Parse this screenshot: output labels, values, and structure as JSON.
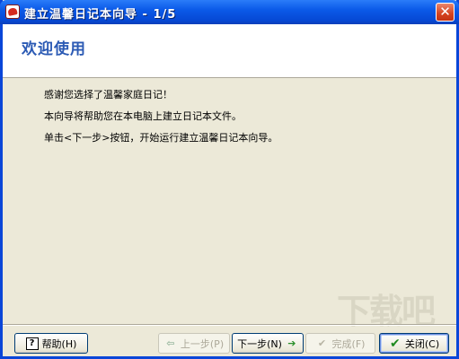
{
  "titlebar": {
    "title": "建立温馨日记本向导 - 1/5",
    "close_label": "✕"
  },
  "header": {
    "title": "欢迎使用"
  },
  "content": {
    "lines": [
      "感谢您选择了温馨家庭日记！",
      "本向导将帮助您在本电脑上建立日记本文件。",
      "单击<下一步>按钮，开始运行建立温馨日记本向导。"
    ]
  },
  "watermark": {
    "text": "下载吧"
  },
  "buttons": {
    "help": {
      "label": "帮助(H)",
      "icon": "help-icon"
    },
    "prev": {
      "label": "上一步(P)",
      "icon": "arrow-left-icon"
    },
    "next": {
      "label": "下一步(N)",
      "icon": "arrow-right-icon"
    },
    "finish": {
      "label": "完成(F)",
      "icon": "checkmark-icon"
    },
    "close": {
      "label": "关闭(C)",
      "icon": "checkmark-icon"
    }
  }
}
